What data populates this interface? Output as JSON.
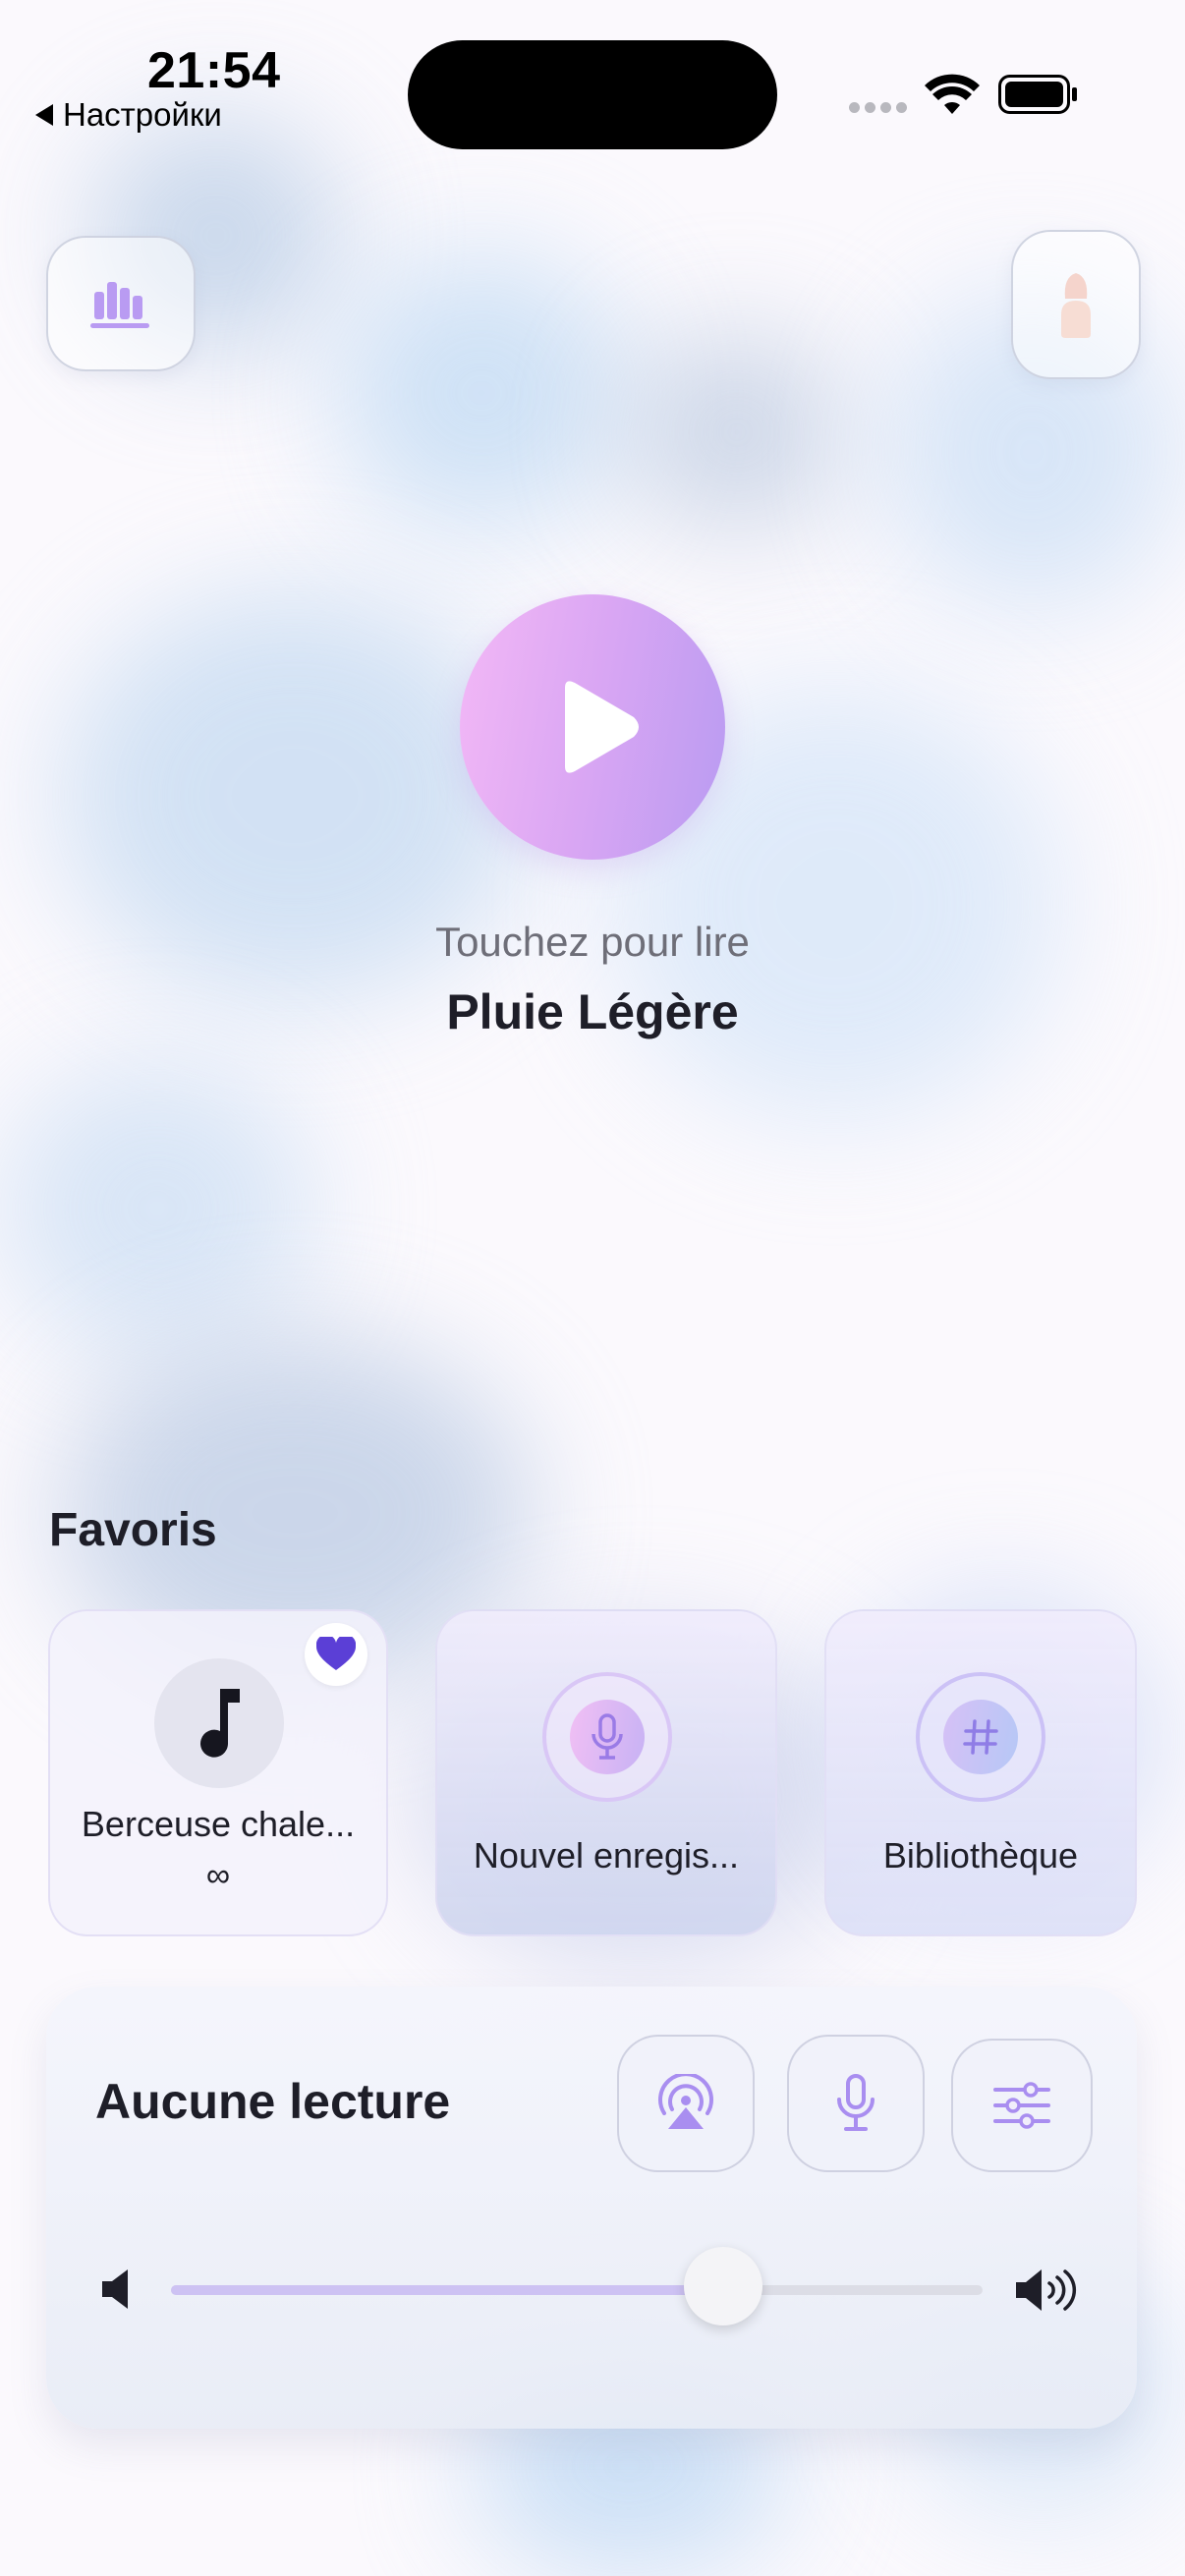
{
  "status_bar": {
    "time": "21:54",
    "back_label": "Настройки"
  },
  "top_bar": {
    "left_button_icon": "chart-bars-icon",
    "right_button_icon": "night-lamp-icon"
  },
  "player": {
    "hint": "Touchez pour lire",
    "track_name": "Pluie Légère"
  },
  "favorites": {
    "title": "Favoris",
    "items": [
      {
        "label": "Berceuse chale...",
        "sublabel": "∞",
        "icon": "music-note-icon",
        "favorite": true
      },
      {
        "label": "Nouvel enregis...",
        "icon": "microphone-icon"
      },
      {
        "label": "Bibliothèque",
        "icon": "grid-hash-icon"
      }
    ]
  },
  "now_playing": {
    "status": "Aucune lecture",
    "buttons": [
      "airplay-icon",
      "microphone-icon",
      "sliders-icon"
    ],
    "volume": 0.68
  },
  "colors": {
    "accent": "#b99bf2",
    "accent_pink": "#f3b8f6",
    "heart": "#5b3fd6"
  }
}
